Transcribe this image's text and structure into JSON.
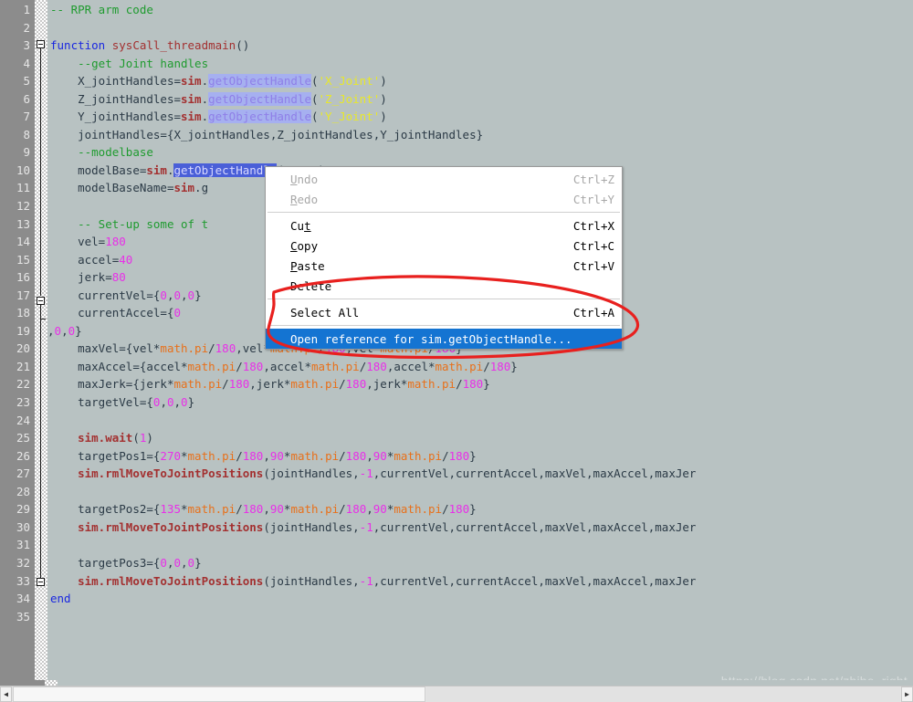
{
  "editor": {
    "background_color": "#b8c2c2",
    "gutter_color": "#8c8c8c",
    "line_number_color": "#e6e6e6",
    "line_numbers": [
      "1",
      "2",
      "3",
      "4",
      "5",
      "6",
      "7",
      "8",
      "9",
      "10",
      "11",
      "12",
      "13",
      "14",
      "15",
      "16",
      "17",
      "18",
      "19",
      "20",
      "21",
      "22",
      "23",
      "24",
      "25",
      "26",
      "27",
      "28",
      "29",
      "30",
      "31",
      "32",
      "33",
      "34",
      "35"
    ],
    "lines": [
      {
        "n": 1,
        "text": "-- RPR arm code"
      },
      {
        "n": 2,
        "text": ""
      },
      {
        "n": 3,
        "text": "function sysCall_threadmain()"
      },
      {
        "n": 4,
        "text": "    --get Joint handles"
      },
      {
        "n": 5,
        "text": "    X_jointHandles=sim.getObjectHandle('X_Joint')"
      },
      {
        "n": 6,
        "text": "    Z_jointHandles=sim.getObjectHandle('Z_Joint')"
      },
      {
        "n": 7,
        "text": "    Y_jointHandles=sim.getObjectHandle('Y_Joint')"
      },
      {
        "n": 8,
        "text": "    jointHandles={X_jointHandles,Z_jointHandles,Y_jointHandles}"
      },
      {
        "n": 9,
        "text": "    --modelbase"
      },
      {
        "n": 10,
        "text": "    modelBase=sim.getObjectHandle('RPR')"
      },
      {
        "n": 11,
        "text": "    modelBaseName=sim.g"
      },
      {
        "n": 12,
        "text": ""
      },
      {
        "n": 13,
        "text": "    -- Set-up some of t"
      },
      {
        "n": 14,
        "text": "    vel=180"
      },
      {
        "n": 15,
        "text": "    accel=40"
      },
      {
        "n": 16,
        "text": "    jerk=80"
      },
      {
        "n": 17,
        "text": "    currentVel={0,0,0}"
      },
      {
        "n": 18,
        "text": "    currentAccel={0"
      },
      {
        "n": 19,
        "text": ",0,0}"
      },
      {
        "n": 20,
        "text": "    maxVel={vel*math.pi/180,vel*math.pi/180,vel*math.pi/180}"
      },
      {
        "n": 21,
        "text": "    maxAccel={accel*math.pi/180,accel*math.pi/180,accel*math.pi/180}"
      },
      {
        "n": 22,
        "text": "    maxJerk={jerk*math.pi/180,jerk*math.pi/180,jerk*math.pi/180}"
      },
      {
        "n": 23,
        "text": "    targetVel={0,0,0}"
      },
      {
        "n": 24,
        "text": ""
      },
      {
        "n": 25,
        "text": "    sim.wait(1)"
      },
      {
        "n": 26,
        "text": "    targetPos1={270*math.pi/180,90*math.pi/180,90*math.pi/180}"
      },
      {
        "n": 27,
        "text": "    sim.rmlMoveToJointPositions(jointHandles,-1,currentVel,currentAccel,maxVel,maxAccel,maxJer"
      },
      {
        "n": 28,
        "text": ""
      },
      {
        "n": 29,
        "text": "    targetPos2={135*math.pi/180,90*math.pi/180,90*math.pi/180}"
      },
      {
        "n": 30,
        "text": "    sim.rmlMoveToJointPositions(jointHandles,-1,currentVel,currentAccel,maxVel,maxAccel,maxJer"
      },
      {
        "n": 31,
        "text": ""
      },
      {
        "n": 32,
        "text": "    targetPos3={0,0,0}"
      },
      {
        "n": 33,
        "text": "    sim.rmlMoveToJointPositions(jointHandles,-1,currentVel,currentAccel,maxVel,maxAccel,maxJer"
      },
      {
        "n": 34,
        "text": "end"
      },
      {
        "n": 35,
        "text": ""
      }
    ],
    "syntax_colors": {
      "comment": "#1f9b2f",
      "keyword": "#1a28e0",
      "function_name": "#a33030",
      "api_object": "#a33030",
      "member": "#8f7fe8",
      "member_highlight_bg": "#a6b0f0",
      "member_selected_bg": "#4a5fd8",
      "string": "#e8e82b",
      "number": "#e830e8",
      "math_lib": "#e8701a",
      "plain": "#2b3a46"
    }
  },
  "context_menu": {
    "items": [
      {
        "label": "Undo",
        "accel_char": "U",
        "shortcut": "Ctrl+Z",
        "disabled": true,
        "selected": false,
        "separator_after": false
      },
      {
        "label": "Redo",
        "accel_char": "R",
        "shortcut": "Ctrl+Y",
        "disabled": true,
        "selected": false,
        "separator_after": true
      },
      {
        "label": "Cut",
        "accel_char": "t",
        "shortcut": "Ctrl+X",
        "disabled": false,
        "selected": false,
        "separator_after": false
      },
      {
        "label": "Copy",
        "accel_char": "C",
        "shortcut": "Ctrl+C",
        "disabled": false,
        "selected": false,
        "separator_after": false
      },
      {
        "label": "Paste",
        "accel_char": "P",
        "shortcut": "Ctrl+V",
        "disabled": false,
        "selected": false,
        "separator_after": false
      },
      {
        "label": "Delete",
        "accel_char": "",
        "shortcut": "",
        "disabled": false,
        "selected": false,
        "separator_after": true
      },
      {
        "label": "Select All",
        "accel_char": "",
        "shortcut": "Ctrl+A",
        "disabled": false,
        "selected": false,
        "separator_after": true
      },
      {
        "label": "Open reference for sim.getObjectHandle...",
        "accel_char": "",
        "shortcut": "",
        "disabled": false,
        "selected": true,
        "separator_after": false
      }
    ],
    "highlight_color": "#1474d2",
    "background_color": "#ffffff"
  },
  "annotation": {
    "shape": "hand-drawn-ellipse",
    "color": "#e8201e",
    "encircles": "Open reference for sim.getObjectHandle..."
  },
  "watermark": {
    "text": "https://blog.csdn.net/zhihe_right",
    "color": "#d6dcdc"
  },
  "scrollbar": {
    "left_arrow_glyph": "◀",
    "right_arrow_glyph": "▶",
    "orientation": "horizontal"
  }
}
